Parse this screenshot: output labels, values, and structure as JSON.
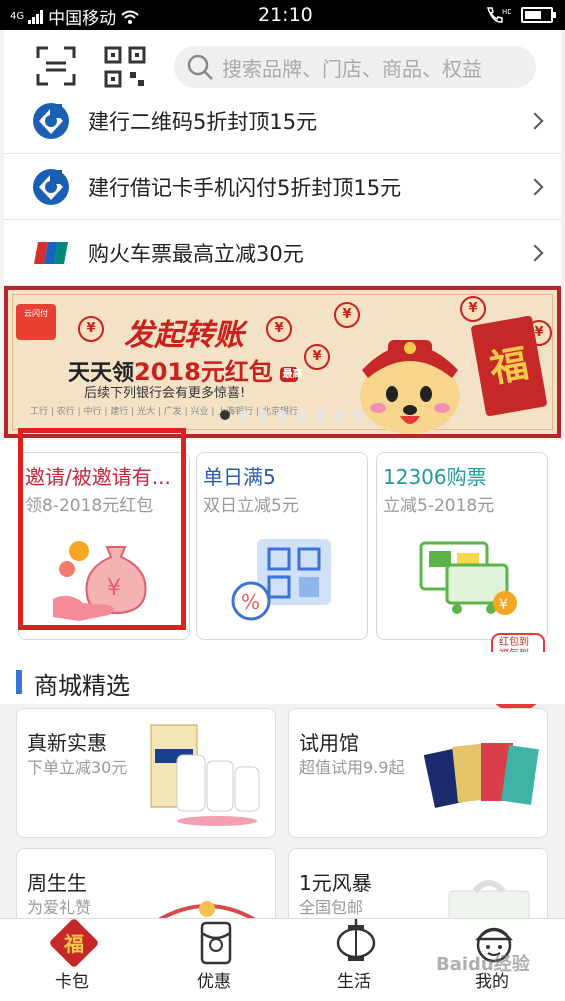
{
  "status_bar": {
    "carrier": "中国移动",
    "network": "4G",
    "time": "21:10",
    "hd_label": "HD"
  },
  "header": {
    "search_placeholder": "搜索品牌、门店、商品、权益",
    "icons": [
      "scan-icon",
      "qrcode-icon",
      "search-icon"
    ]
  },
  "promo_list": [
    {
      "label": "建行二维码5折封顶15元",
      "logo": "ccb-logo"
    },
    {
      "label": "建行借记卡手机闪付5折封顶15元",
      "logo": "ccb-logo"
    },
    {
      "label": "购火车票最高立减30元",
      "logo": "unionpay-logo"
    }
  ],
  "banner": {
    "app_badge": "云闪付",
    "title": "发起转账",
    "subtitle_prefix": "天天领",
    "subtitle_amount": "2018元红包",
    "tag": "最高",
    "note": "后续下列银行会有更多惊喜!",
    "banks": "工行 | 农行 | 中行 | 建行 | 光大 | 广发 | 兴业 | 上海银行 | 北京银行",
    "envelope_char": "福",
    "page_count": 8,
    "active_page": 0
  },
  "feature_cards": [
    {
      "title": "邀请/被邀请有...",
      "subtitle": "领8-2018元红包",
      "title_color": "#c8253a",
      "icon": "money-bag-hand-icon",
      "highlighted": true
    },
    {
      "title": "单日满5",
      "subtitle": "双日立减5元",
      "title_color": "#2b5aa8",
      "icon": "qr-discount-icon",
      "highlighted": false
    },
    {
      "title": "12306购票",
      "subtitle": "立减5-2018元",
      "title_color": "#1e9aa0",
      "icon": "train-ticket-icon",
      "highlighted": false
    }
  ],
  "floating_badge": {
    "text_line1": "红包到",
    "text_line2": "福气到"
  },
  "section": {
    "title": "商城精选"
  },
  "products": [
    {
      "title": "真新实惠",
      "subtitle": "下单立减30元",
      "image": "supplement-bottles-image"
    },
    {
      "title": "试用馆",
      "subtitle": "超值试用9.9起",
      "image": "face-masks-image"
    },
    {
      "title": "周生生",
      "subtitle": "为爱礼赞",
      "image": "bracelet-image"
    },
    {
      "title": "1元风暴",
      "subtitle": "全国包邮",
      "image": "tissue-image"
    }
  ],
  "bottom_nav": [
    {
      "label": "卡包",
      "icon": "card-wallet-icon",
      "active": true
    },
    {
      "label": "优惠",
      "icon": "coupon-envelope-icon",
      "active": false
    },
    {
      "label": "生活",
      "icon": "lantern-icon",
      "active": false
    },
    {
      "label": "我的",
      "icon": "profile-icon",
      "active": false
    }
  ],
  "watermark": "Baidu经验",
  "colors": {
    "accent_red": "#c9221d",
    "accent_blue": "#3b74d6",
    "highlight_box": "#e02020"
  }
}
